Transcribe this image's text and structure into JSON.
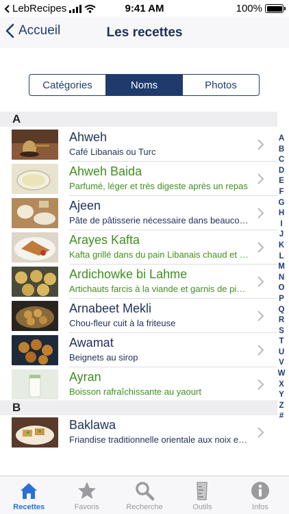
{
  "status": {
    "carrier": "LebRecipes",
    "time": "9:41 AM",
    "battery": "100%"
  },
  "nav": {
    "back_label": "Accueil",
    "title": "Les recettes"
  },
  "segments": [
    {
      "label": "Catégories",
      "active": false
    },
    {
      "label": "Noms",
      "active": true
    },
    {
      "label": "Photos",
      "active": false
    }
  ],
  "sections": [
    {
      "letter": "A",
      "rows": [
        {
          "title": "Ahweh",
          "subtitle": "Café Libanais ou Turc",
          "color": "blue"
        },
        {
          "title": "Ahweh Baida",
          "subtitle": "Parfumé, léger et très digeste après un repas",
          "color": "green"
        },
        {
          "title": "Ajeen",
          "subtitle": "Pâte de pâtisserie nécessaire dans beaucoup de recettes",
          "color": "blue"
        },
        {
          "title": "Arayes Kafta",
          "subtitle": "Kafta grillé dans du pain Libanais chaud et croustillant",
          "color": "green"
        },
        {
          "title": "Ardichowke bi Lahme",
          "subtitle": "Artichauts farcis à la viande et garnis de pignons",
          "color": "green"
        },
        {
          "title": "Arnabeet Mekli",
          "subtitle": "Chou-fleur cuit à la friteuse",
          "color": "blue"
        },
        {
          "title": "Awamat",
          "subtitle": "Beignets au sirop",
          "color": "blue"
        },
        {
          "title": "Ayran",
          "subtitle": "Boisson rafraîchissante au yaourt",
          "color": "green"
        }
      ]
    },
    {
      "letter": "B",
      "rows": [
        {
          "title": "Baklawa",
          "subtitle": "Friandise traditionnelle orientale aux noix et pistaches",
          "color": "blue"
        }
      ]
    }
  ],
  "index_letters": [
    "A",
    "B",
    "C",
    "D",
    "E",
    "F",
    "G",
    "H",
    "I",
    "J",
    "K",
    "L",
    "M",
    "N",
    "O",
    "P",
    "Q",
    "R",
    "S",
    "T",
    "U",
    "V",
    "W",
    "X",
    "Y",
    "Z",
    "#"
  ],
  "tabs": [
    {
      "label": "Recettes",
      "icon": "house-icon",
      "active": true
    },
    {
      "label": "Favoris",
      "icon": "star-icon",
      "active": false
    },
    {
      "label": "Recherche",
      "icon": "magnifier-icon",
      "active": false
    },
    {
      "label": "Outils",
      "icon": "measuring-cup-icon",
      "active": false
    },
    {
      "label": "Infos",
      "icon": "info-icon",
      "active": false
    }
  ],
  "colors": {
    "accent": "#1f3b6e",
    "green_text": "#3f8f1f",
    "tab_active": "#2b6fd6",
    "tab_inactive": "#9a9a9f"
  }
}
